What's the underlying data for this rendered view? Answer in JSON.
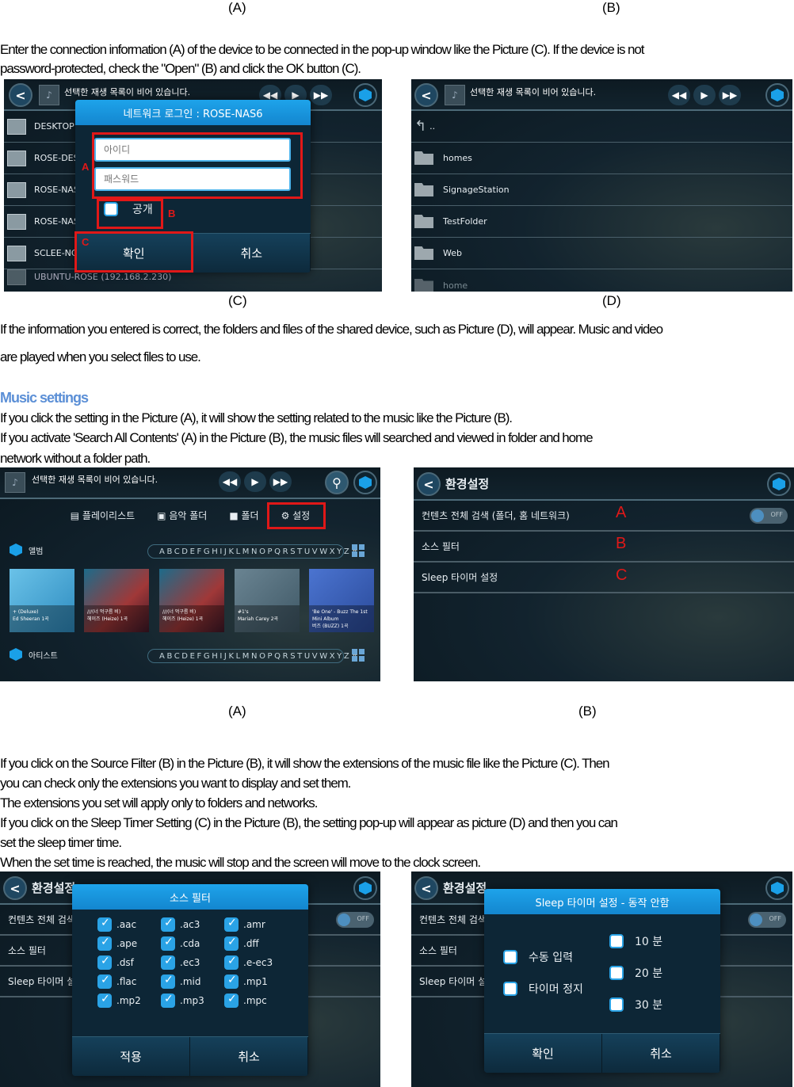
{
  "captions": {
    "top_a": "(A)",
    "top_b": "(B)",
    "c": "(C)",
    "d": "(D)",
    "mid_a": "(A)",
    "mid_b": "(B)"
  },
  "paragraphs": {
    "p1_line1": "Enter the connection information (A) of the device to be connected in the pop-up window like the Picture (C). If the device is not",
    "p1_line2": "password-protected, check the \"Open\" (B) and click the OK button (C).",
    "p2_line1": "If the information you entered is correct, the folders and files of the shared device, such as Picture (D), will appear. Music and video",
    "p2_line2": "are played when you select files to use.",
    "music_heading": "Music settings",
    "p3_line1": "If you click the setting in the Picture (A), it will show the setting related to the music like the Picture (B).",
    "p3_line2": "If you activate 'Search All Contents' (A) in the Picture (B), the music files will searched and viewed in folder and home",
    "p3_line3": "network without a folder path.",
    "p4_line1": "If you click on the Source Filter (B) in the Picture (B), it will show the extensions of the music file like the Picture (C). Then",
    "p4_line2": "you can check only the extensions you want to display and set them.",
    "p4_line3": "The extensions you set will apply only to folders and networks.",
    "p4_line4": "If you click on the Sleep Timer Setting (C) in the Picture (B), the setting pop-up will appear as picture (D) and then you can",
    "p4_line5": "set the sleep timer time.",
    "p4_line6": "When the set time is reached, the music will stop and the screen will move to the clock screen."
  },
  "player": {
    "now_playing": "선택한 재생 목록이 비어 있습니다.",
    "prev": "◀◀",
    "play": "▶",
    "next": "▶▶",
    "back": "<"
  },
  "screen_c": {
    "devices": [
      "DESKTOP",
      "ROSE-DES",
      "ROSE-NAS",
      "ROSE-NAS",
      "SCLEE-NC",
      "UBUNTU-ROSE (192.168.2.230)"
    ],
    "popup_title": "네트워크 로그인 :  ROSE-NAS6",
    "id_placeholder": "아이디",
    "password_placeholder": "패스워드",
    "open_label": "공개",
    "ok_label": "확인",
    "cancel_label": "취소",
    "marker_a": "A",
    "marker_b": "B",
    "marker_c": "C"
  },
  "screen_d": {
    "up_label": "..",
    "folders": [
      "homes",
      "SignageStation",
      "TestFolder",
      "Web",
      "home"
    ]
  },
  "screen_music": {
    "tabs": [
      {
        "label": "플레이리스트",
        "icon": "playlist-icon"
      },
      {
        "label": "음악 폴더",
        "icon": "music-folder-icon"
      },
      {
        "label": "폴더",
        "icon": "folder-icon"
      },
      {
        "label": "설정",
        "icon": "gear-icon"
      }
    ],
    "section_album": "앨범",
    "section_artist": "아티스트",
    "alphabet": "ABCDEFGHIJKLMNOPQRSTUVWXYZ#",
    "albums": [
      {
        "title": "+ (Deluxe)",
        "artist": "Ed Sheeran 1곡",
        "color": "#3a9fd0"
      },
      {
        "title": "///(너 먹구름 비)",
        "artist": "헤이즈 (Heize) 1곡",
        "color": "#7a2a3a"
      },
      {
        "title": "///(너 먹구름 비)",
        "artist": "헤이즈 (Heize) 1곡",
        "color": "#7a2a3a"
      },
      {
        "title": "#1's",
        "artist": "Mariah Carey 2곡",
        "color": "#5b7482"
      },
      {
        "title": "'Be One' - Buzz The 1st Mini Album",
        "artist": "버즈 (BUZZ) 1곡",
        "color": "#3d5fb0"
      }
    ]
  },
  "screen_settings": {
    "title": "환경설정",
    "rows": [
      {
        "label": "컨텐츠 전체 검색 (폴더, 홈 네트워크)",
        "marker": "A",
        "toggle": "OFF"
      },
      {
        "label": "소스 필터",
        "marker": "B"
      },
      {
        "label": "Sleep 타이머 설정",
        "marker": "C"
      }
    ]
  },
  "source_filter": {
    "title": "소스 필터",
    "extensions": [
      {
        "ext": ".aac",
        "checked": true
      },
      {
        "ext": ".ac3",
        "checked": true
      },
      {
        "ext": ".amr",
        "checked": true
      },
      {
        "ext": ".ape",
        "checked": true
      },
      {
        "ext": ".cda",
        "checked": true
      },
      {
        "ext": ".dff",
        "checked": true
      },
      {
        "ext": ".dsf",
        "checked": true
      },
      {
        "ext": ".ec3",
        "checked": true
      },
      {
        "ext": ".e-ec3",
        "checked": true
      },
      {
        "ext": ".flac",
        "checked": true
      },
      {
        "ext": ".mid",
        "checked": true
      },
      {
        "ext": ".mp1",
        "checked": true
      },
      {
        "ext": ".mp2",
        "checked": true
      },
      {
        "ext": ".mp3",
        "checked": true
      },
      {
        "ext": ".mpc",
        "checked": true
      }
    ],
    "apply_label": "적용",
    "cancel_label": "취소"
  },
  "sleep_timer": {
    "title": "Sleep 타이머 설정  -  동작 안함",
    "left_options": [
      "수동 입력",
      "타이머 정지"
    ],
    "right_options": [
      "10 분",
      "20 분",
      "30 분"
    ],
    "ok_label": "확인",
    "cancel_label": "취소"
  },
  "colors": {
    "accent": "#1ea3ea",
    "highlight": "#e01818",
    "heading": "#5b8fd6"
  }
}
